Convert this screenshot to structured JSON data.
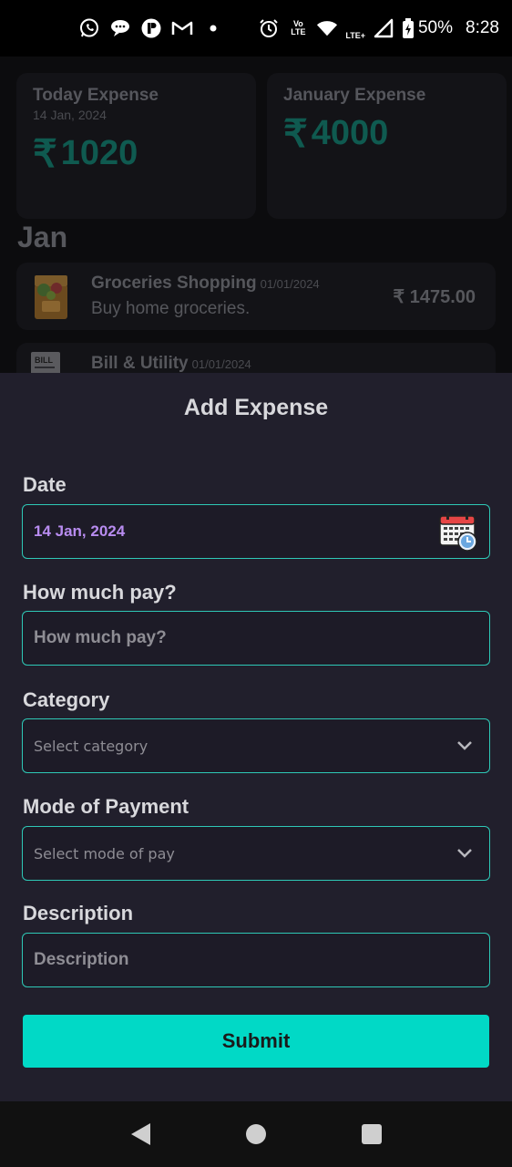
{
  "status_bar": {
    "battery_percent": "50%",
    "time": "8:28",
    "network_label": "Vo LTE",
    "lte_label": "LTE+",
    "notification_icons": [
      "whatsapp-icon",
      "chat-bubble-icon",
      "app-icon",
      "gmail-icon",
      "dot-icon"
    ]
  },
  "background": {
    "today_card": {
      "title": "Today Expense",
      "date": "14 Jan, 2024",
      "currency": "₹",
      "amount": "1020"
    },
    "month_card": {
      "title": "January Expense",
      "currency": "₹",
      "amount": "4000"
    },
    "month_label": "Jan",
    "expenses": [
      {
        "name": "Groceries Shopping",
        "date": "01/01/2024",
        "desc": "Buy home groceries.",
        "price": "₹ 1475.00"
      },
      {
        "name": "Bill & Utility",
        "date": "01/01/2024",
        "desc": "",
        "price": ""
      }
    ]
  },
  "sheet": {
    "title": "Add Expense",
    "date": {
      "label": "Date",
      "value": "14 Jan, 2024"
    },
    "amount": {
      "label": "How much pay?",
      "placeholder": "How much pay?"
    },
    "category": {
      "label": "Category",
      "placeholder": "Select category"
    },
    "mode": {
      "label": "Mode of Payment",
      "placeholder": "Select mode of pay"
    },
    "description": {
      "label": "Description",
      "placeholder": "Description"
    },
    "submit_label": "Submit"
  },
  "colors": {
    "accent": "#01d9c6",
    "sheet_bg": "#211f2c",
    "date_value": "#b88cf0"
  }
}
